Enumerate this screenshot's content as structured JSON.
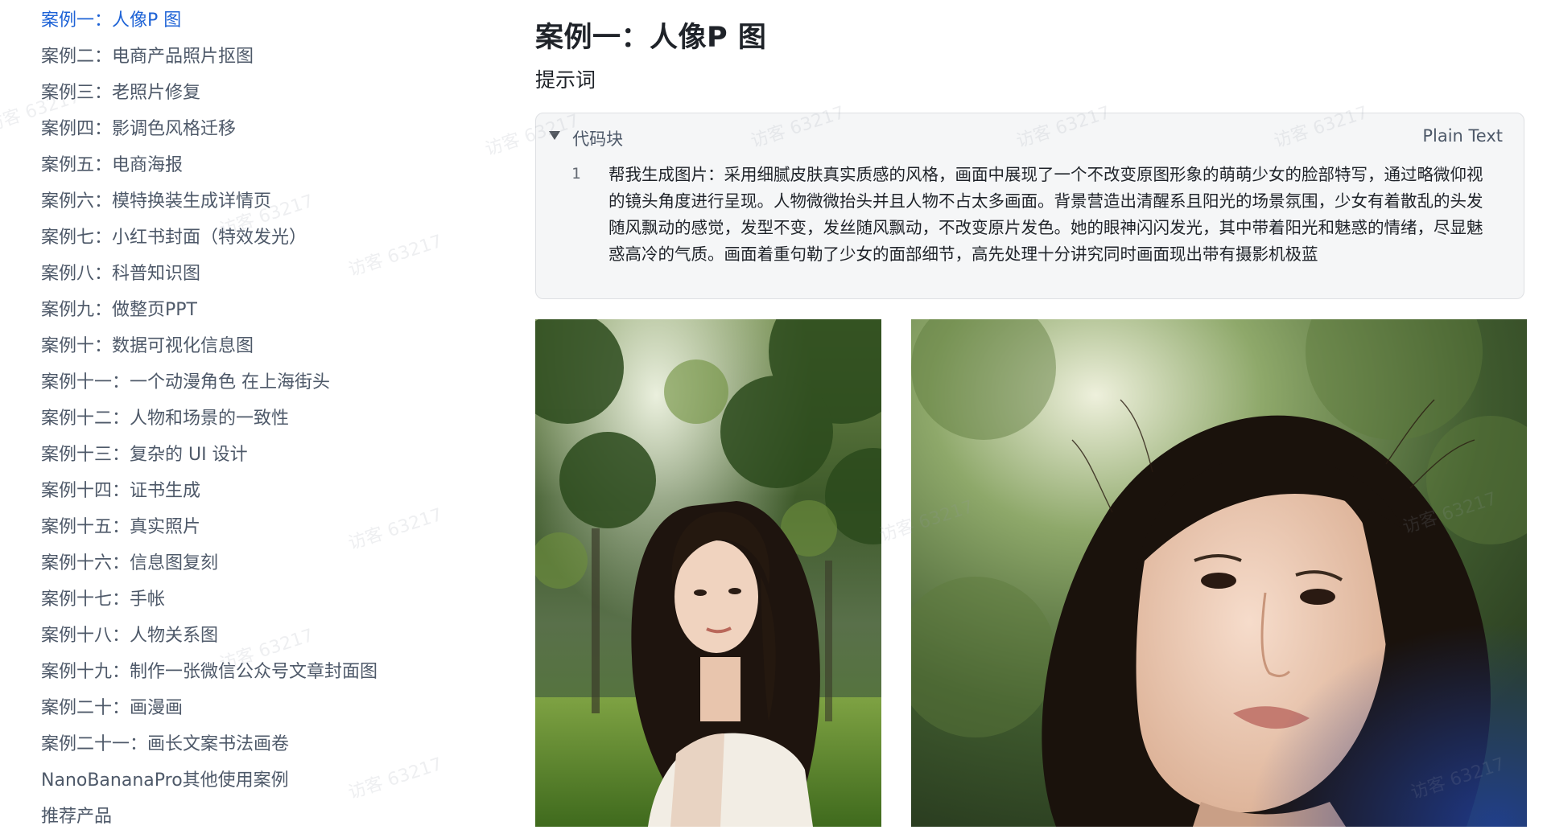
{
  "toc": {
    "items": [
      "案例一：人像P 图",
      "案例二：电商产品照片抠图",
      "案例三：老照片修复",
      "案例四：影调色风格迁移",
      "案例五：电商海报",
      "案例六：模特换装生成详情页",
      "案例七：小红书封面（特效发光）",
      "案例八：科普知识图",
      "案例九：做整页PPT",
      "案例十：数据可视化信息图",
      "案例十一：一个动漫角色 在上海街头",
      "案例十二：人物和场景的一致性",
      "案例十三：复杂的 UI 设计",
      "案例十四：证书生成",
      "案例十五：真实照片",
      "案例十六：信息图复刻",
      "案例十七：手帐",
      "案例十八：人物关系图",
      "案例十九：制作一张微信公众号文章封面图",
      "案例二十：画漫画",
      "案例二十一：画长文案书法画卷",
      "NanoBananaPro其他使用案例",
      "推荐产品"
    ],
    "active_index": 0,
    "active_color": "#1e63d6"
  },
  "main": {
    "title": "案例一：人像P 图",
    "section_label": "提示词",
    "code_block": {
      "title": "代码块",
      "language": "Plain Text",
      "line_number": "1",
      "text": "帮我生成图片：采用细腻皮肤真实质感的风格，画面中展现了一个不改变原图形象的萌萌少女的脸部特写，通过略微仰视的镜头角度进行呈现。人物微微抬头并且人物不占太多画面。背景营造出清醒系且阳光的场景氛围，少女有着散乱的头发随风飘动的感觉，发型不变，发丝随风飘动，不改变原片发色。她的眼神闪闪发光，其中带着阳光和魅惑的情绪，尽显魅惑高冷的气质。画面着重句勒了少女的面部细节，高先处理十分讲究同时画面现出带有摄影机极蓝"
    }
  },
  "watermark": {
    "text": "访客 63217"
  }
}
